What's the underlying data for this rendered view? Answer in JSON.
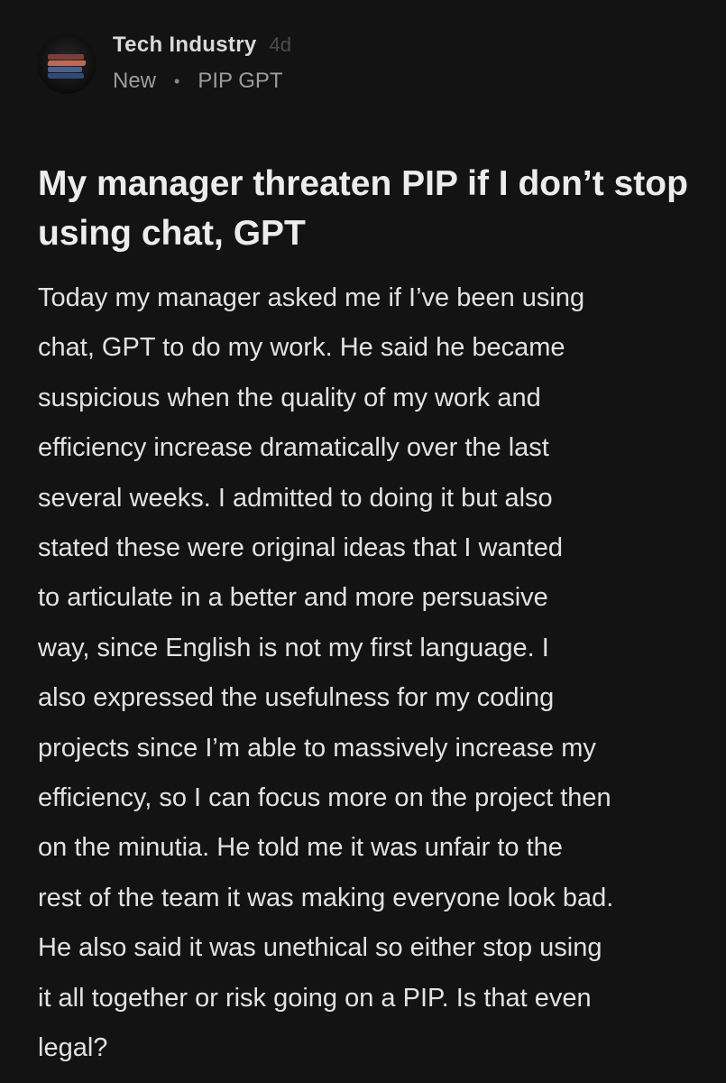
{
  "header": {
    "community": "Tech Industry",
    "age": "4d",
    "sort_label": "New",
    "separator": "•",
    "flair": "PIP GPT",
    "avatar_icon": "books-stack-icon"
  },
  "post": {
    "title": "My manager threaten PIP if I don’t stop using chat, GPT",
    "body": "Today my manager asked me if I’ve been using\nchat, GPT to do my work. He said he became\nsuspicious when the quality of my work and\nefficiency increase dramatically over the last\nseveral weeks. I admitted to doing it but also\nstated these were original ideas that I wanted\nto articulate in a better and more persuasive\nway, since English is not my first language. I\nalso expressed the usefulness for my coding\nprojects since I’m able to massively increase my\nefficiency, so I can focus more on the project then\non the minutia. He told me it was unfair to the\nrest of the team it was making everyone look bad.\nHe also said it was unethical so either stop using\nit all together or risk going on a PIP. Is that even\nlegal?"
  }
}
